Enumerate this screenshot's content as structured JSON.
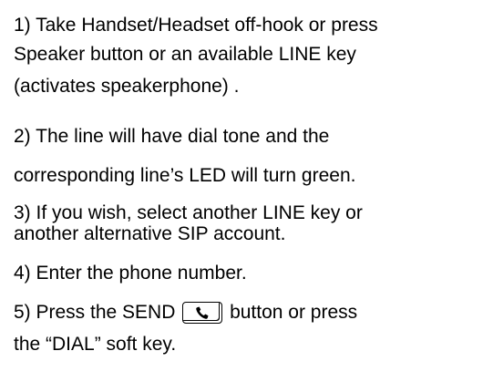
{
  "steps": {
    "line_1": "1) Take Handset/Headset off-hook or press",
    "line_2": "Speaker button or an available LINE key",
    "line_3": "(activates speakerphone) .",
    "line_4": "2) The line will have dial tone and the",
    "line_5": "corresponding line’s  LED will turn green.",
    "line_6": "3) If you wish, select another LINE key or",
    "line_7": "another alternative SIP account.",
    "line_8": "4) Enter the phone number.",
    "line_9_before": "5) Press the SEND ",
    "line_9_after": " button  or press",
    "line_10": "the “DIAL” soft key."
  },
  "icons": {
    "send_key_icon": "phone-handset-icon"
  }
}
